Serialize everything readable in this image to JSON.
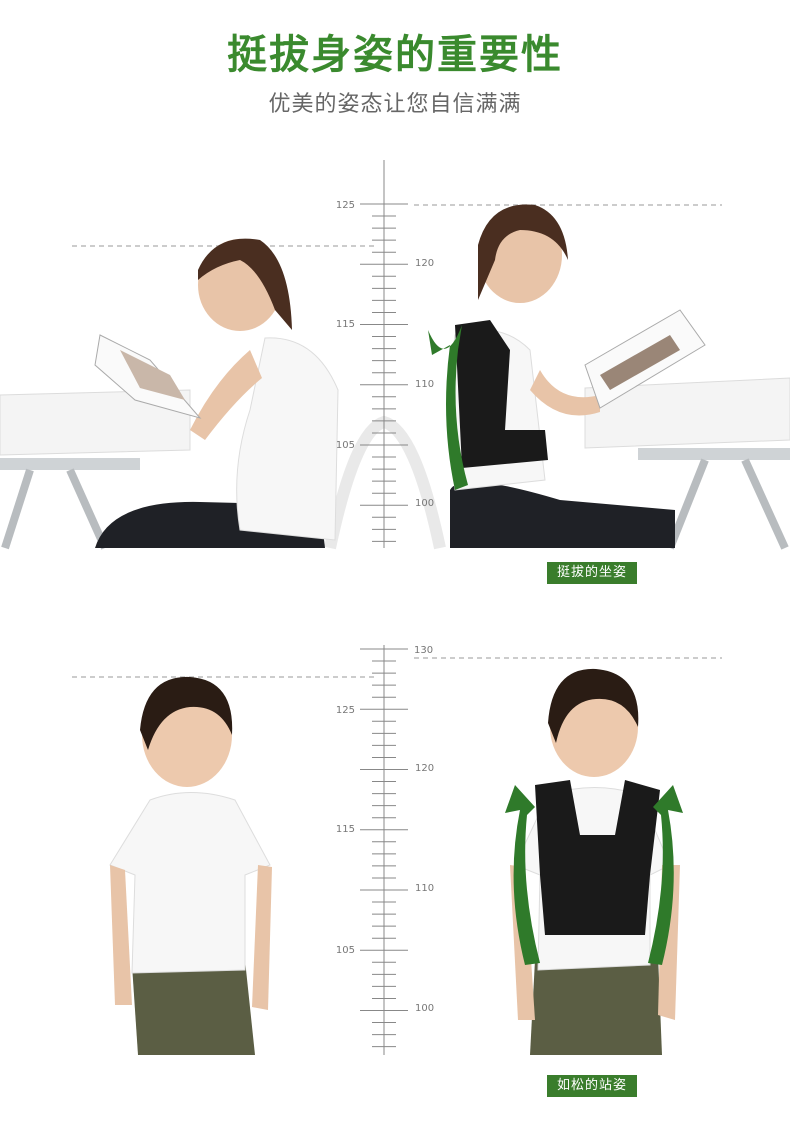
{
  "header": {
    "title": "挺拔身姿的重要性",
    "subtitle": "优美的姿态让您自信满满"
  },
  "sitting": {
    "ruler_labels_left": [
      "125",
      "115",
      "105"
    ],
    "ruler_labels_right": [
      "120",
      "110",
      "100"
    ],
    "badge": "挺拔的坐姿"
  },
  "standing": {
    "ruler_labels_top": "130",
    "ruler_labels_left": [
      "125",
      "115",
      "105"
    ],
    "ruler_labels_right": [
      "120",
      "110",
      "100"
    ],
    "badge": "如松的站姿"
  },
  "colors": {
    "accent": "#3a7d2c",
    "title": "#3a8a2e",
    "arrow": "#2f7a2a"
  }
}
